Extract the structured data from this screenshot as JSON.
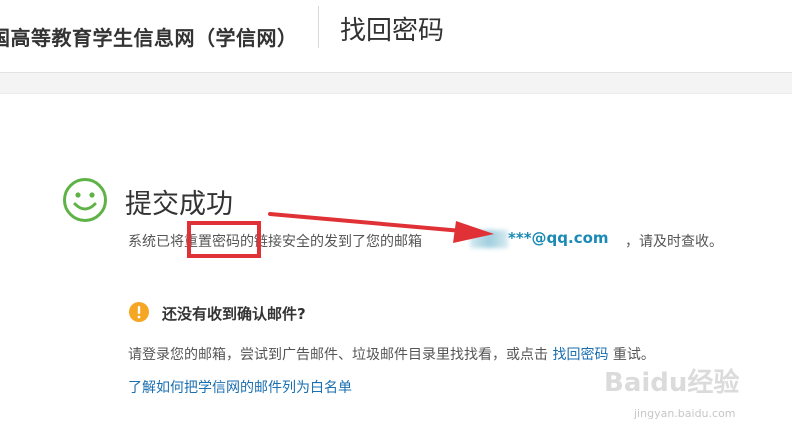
{
  "header": {
    "site_name": "国高等教育学生信息网（学信网）",
    "page_title": "找回密码"
  },
  "result": {
    "title": "提交成功",
    "message_before": "系统已将重置密码的链接安全的发到了您的邮箱",
    "email": "***@qq.com",
    "message_after": "，请及时查收。"
  },
  "help": {
    "question": "还没有收到确认邮件?",
    "text_before": "请登录您的邮箱，尝试到广告邮件、垃圾邮件目录里找找看，或点击",
    "link_label": "找回密码",
    "text_after": "重试。",
    "whitelist_link": "了解如何把学信网的邮件列为白名单"
  },
  "watermark": {
    "logo": "Baidu经验",
    "url": "jingyan.baidu.com"
  },
  "colors": {
    "success_green": "#5fb346",
    "warning_orange": "#f5a623",
    "link_blue": "#1a6fb0",
    "email_blue": "#1a8ab4",
    "annotation_red": "#e03236"
  },
  "icons": {
    "success": "smile-icon",
    "warning": "exclamation-icon"
  }
}
